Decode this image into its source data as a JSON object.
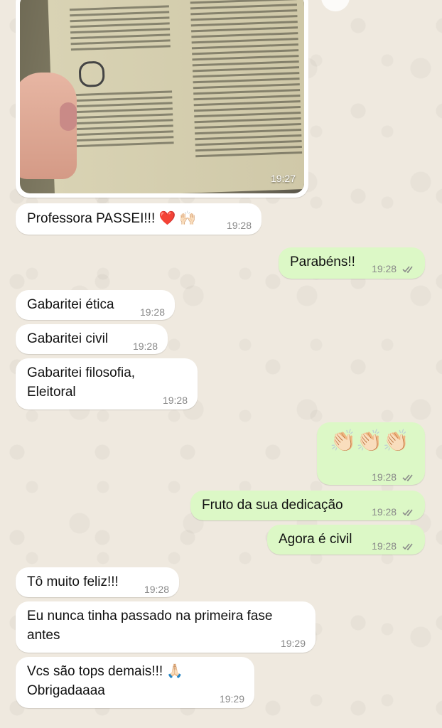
{
  "photo": {
    "time": "19:27",
    "icon": "document-photo"
  },
  "messages": [
    {
      "dir": "in",
      "text": "Professora PASSEI!!! ❤️ 🙌🏻",
      "time": "19:28"
    },
    {
      "dir": "out",
      "text": "Parabéns!!",
      "time": "19:28",
      "status": "read-double-check"
    },
    {
      "dir": "in",
      "text": "Gabaritei ética",
      "time": "19:28"
    },
    {
      "dir": "in",
      "text": "Gabaritei civil",
      "time": "19:28"
    },
    {
      "dir": "in",
      "line1": "Gabaritei filosofia,",
      "line2": "Eleitoral",
      "time": "19:28"
    },
    {
      "dir": "out",
      "text": "👏🏻👏🏻👏🏻",
      "time": "19:28",
      "status": "read-double-check"
    },
    {
      "dir": "out",
      "text": "Fruto da sua dedicação",
      "time": "19:28",
      "status": "read-double-check"
    },
    {
      "dir": "out",
      "text": "Agora é civil",
      "time": "19:28",
      "status": "read-double-check"
    },
    {
      "dir": "in",
      "text": "Tô muito feliz!!!",
      "time": "19:28"
    },
    {
      "dir": "in",
      "line1": "Eu nunca tinha passado na primeira fase",
      "line2": "antes",
      "time": "19:29"
    },
    {
      "dir": "in",
      "line1": "Vcs são tops demais!!! 🙏🏻",
      "line2": "Obrigadaaaa",
      "time": "19:29"
    }
  ],
  "colors": {
    "incoming": "#ffffff",
    "outgoing": "#dcf8c6",
    "background": "#efe9df",
    "ticks": "#8a8a8a"
  }
}
